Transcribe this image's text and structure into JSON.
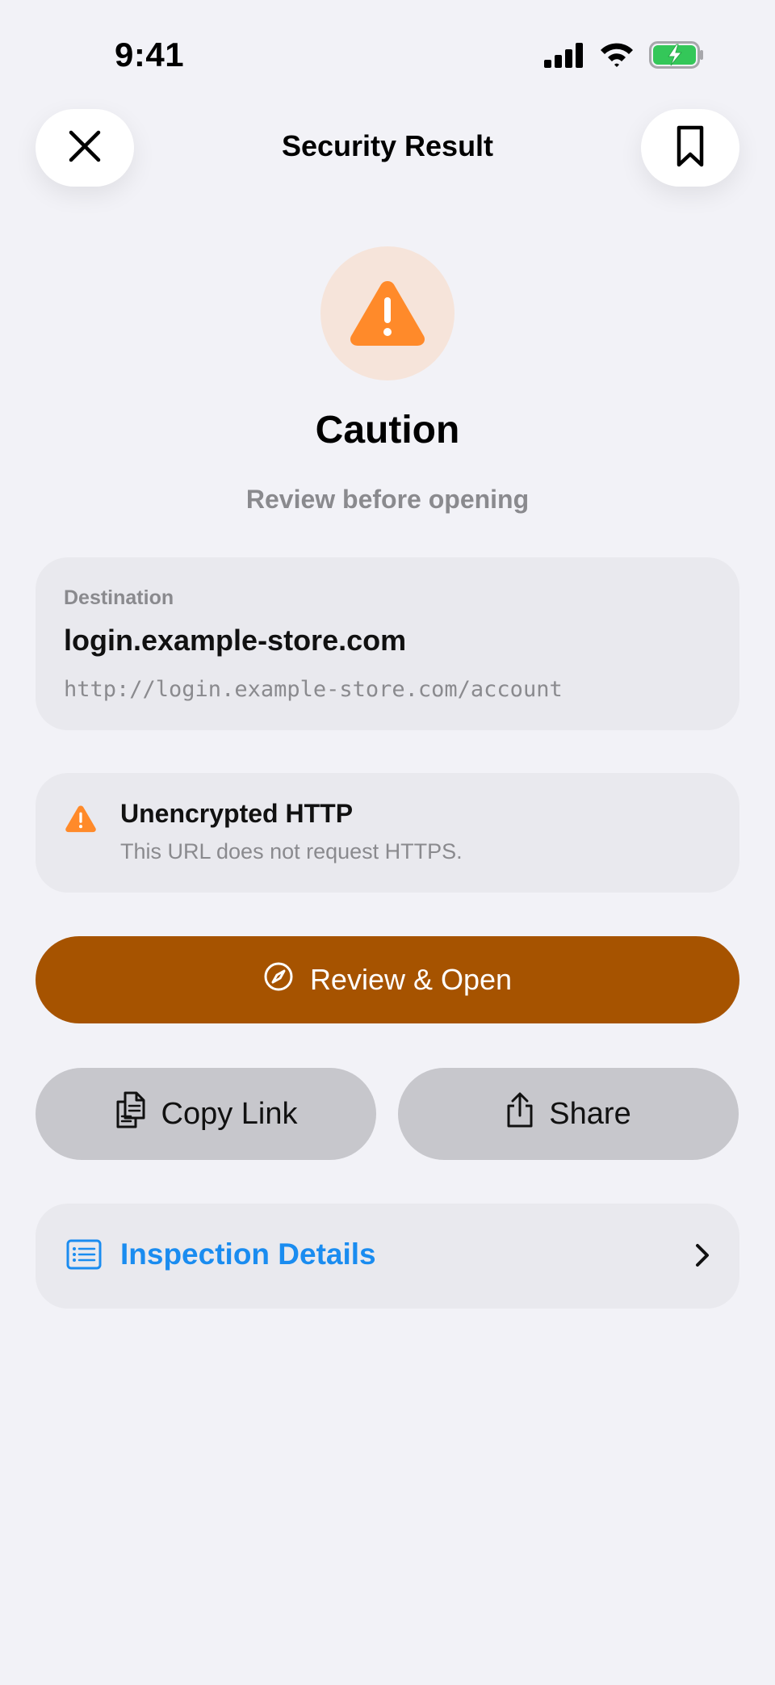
{
  "status_bar": {
    "time": "9:41"
  },
  "nav": {
    "title": "Security Result",
    "close_icon": "close-icon",
    "bookmark_icon": "bookmark-icon"
  },
  "hero": {
    "icon": "warning-triangle-icon",
    "title": "Caution",
    "subtitle": "Review before opening"
  },
  "destination": {
    "label": "Destination",
    "host": "login.example-store.com",
    "url": "http://login.example-store.com/account"
  },
  "warning": {
    "icon": "warning-triangle-icon",
    "title": "Unencrypted HTTP",
    "description": "This URL does not request HTTPS."
  },
  "actions": {
    "primary_label": "Review & Open",
    "primary_icon": "compass-icon",
    "copy_label": "Copy Link",
    "copy_icon": "copy-icon",
    "share_label": "Share",
    "share_icon": "share-icon"
  },
  "details": {
    "label": "Inspection Details",
    "icon": "list-icon"
  },
  "colors": {
    "background": "#f2f2f7",
    "warning_orange": "#ff8a2a",
    "primary_button": "#a65300",
    "link_blue": "#1a8cf0",
    "battery_green": "#34c759"
  }
}
